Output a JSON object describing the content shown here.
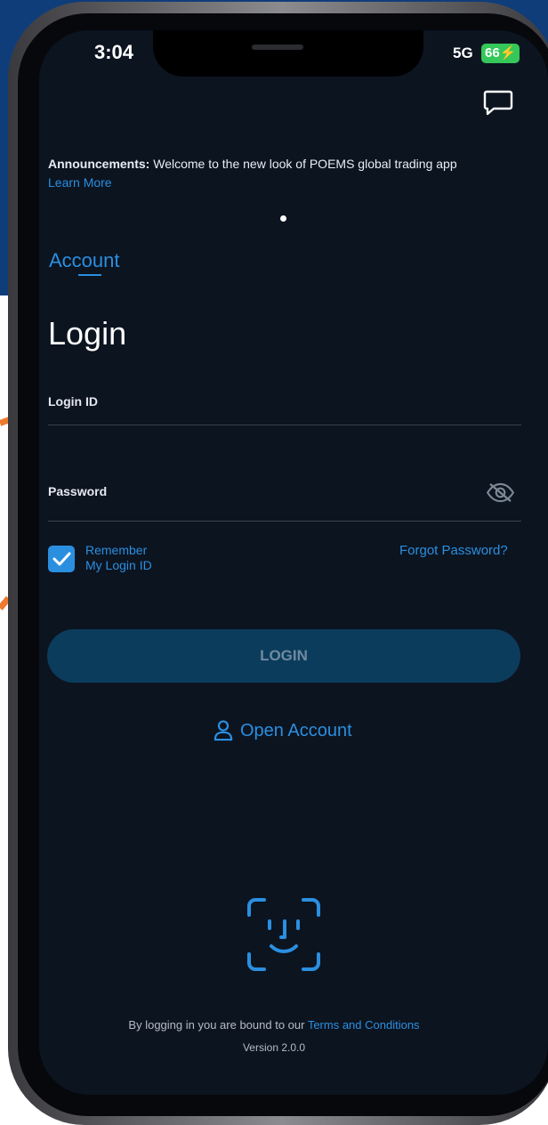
{
  "status_bar": {
    "time": "3:04",
    "network": "5G",
    "battery": "66"
  },
  "announcement": {
    "label": "Announcements:",
    "text": " Welcome to the new look of POEMS global trading app",
    "link": "Learn More"
  },
  "tabs": {
    "active": "Account"
  },
  "page_title": "Login",
  "fields": {
    "login_id_label": "Login ID",
    "login_id_value": "",
    "password_label": "Password",
    "password_value": ""
  },
  "remember": {
    "line1": "Remember",
    "line2": "My Login ID",
    "checked": true
  },
  "forgot_password": "Forgot Password?",
  "login_button": "LOGIN",
  "open_account": "Open Account",
  "footer": {
    "terms_prefix": "By logging in you are bound to our ",
    "terms_link": "Terms and Conditions",
    "version": "Version 2.0.0"
  },
  "colors": {
    "accent": "#2b8fe0",
    "background": "#0c1420",
    "button": "#0b3c5c",
    "annotation": "#ec7a2f",
    "slide_blue": "#0f3d7a"
  },
  "icons": [
    "chat-icon",
    "eye-slash-icon",
    "checkmark-icon",
    "person-icon",
    "face-id-icon"
  ]
}
